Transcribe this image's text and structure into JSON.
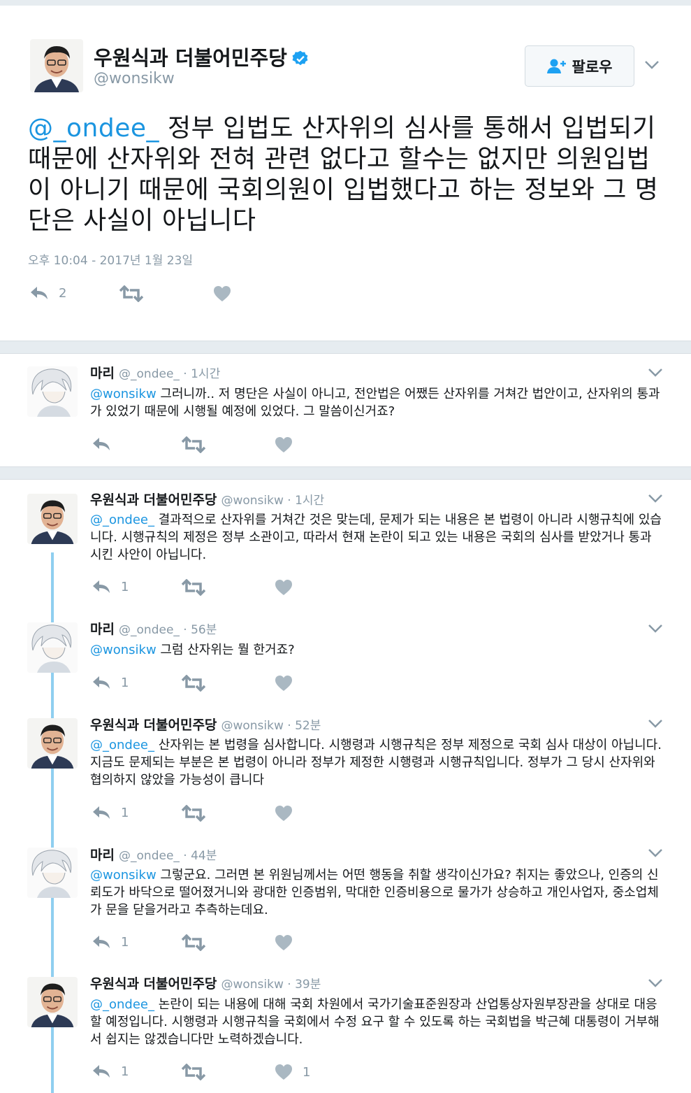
{
  "main_tweet": {
    "display_name": "우원식과 더불어민주당",
    "handle": "@wonsikw",
    "follow_label": "팔로우",
    "mention": "@_ondee_",
    "text": " 정부 입법도 산자위의 심사를 통해서 입법되기 때문에 산자위와 전혀 관련 없다고 할수는 없지만 의원입법이 아니기 때문에 국회의원이 입법했다고 하는 정보와 그 명단은 사실이 아닙니다",
    "timestamp": "오후 10:04 - 2017년 1월 23일",
    "reply_count": "2"
  },
  "replies": [
    {
      "name": "마리",
      "meta": "@_ondee_ · 1시간",
      "mention": "@wonsikw",
      "text": " 그러니까.. 저 명단은 사실이 아니고, 전안법은 어쨌든 산자위를 거쳐간 법안이고, 산자위의 통과가 있었기 때문에 시행될 예정에 있었다. 그 말씀이신거죠?",
      "reply_count": "",
      "like_count": ""
    },
    {
      "name": "우원식과 더불어민주당",
      "meta": "@wonsikw · 1시간",
      "mention": "@_ondee_",
      "text": " 결과적으로 산자위를 거쳐간 것은 맞는데, 문제가 되는 내용은 본 법령이 아니라 시행규칙에 있습니다. 시행규칙의 제정은 정부 소관이고, 따라서 현재 논란이 되고 있는 내용은 국회의 심사를 받았거나 통과시킨 사안이 아닙니다.",
      "reply_count": "1",
      "like_count": ""
    },
    {
      "name": "마리",
      "meta": "@_ondee_ · 56분",
      "mention": "@wonsikw",
      "text": " 그럼 산자위는 뭘 한거죠?",
      "reply_count": "1",
      "like_count": ""
    },
    {
      "name": "우원식과 더불어민주당",
      "meta": "@wonsikw · 52분",
      "mention": "@_ondee_",
      "text": " 산자위는 본 법령을 심사합니다. 시행령과 시행규칙은 정부 제정으로 국회 심사 대상이 아닙니다. 지금도 문제되는 부분은 본 법령이 아니라 정부가 제정한 시행령과 시행규칙입니다. 정부가 그 당시 산자위와 협의하지 않았을 가능성이 큽니다",
      "reply_count": "1",
      "like_count": ""
    },
    {
      "name": "마리",
      "meta": "@_ondee_ · 44분",
      "mention": "@wonsikw",
      "text": " 그렇군요. 그러면 본 위원님께서는 어떤 행동을 취할 생각이신가요? 취지는 좋았으나, 인증의 신뢰도가 바닥으로 떨어졌거니와 광대한 인증범위, 막대한 인증비용으로 물가가 상승하고 개인사업자, 중소업체가 문을 닫을거라고 추측하는데요.",
      "reply_count": "1",
      "like_count": ""
    },
    {
      "name": "우원식과 더불어민주당",
      "meta": "@wonsikw · 39분",
      "mention": "@_ondee_",
      "text": " 논란이 되는 내용에 대해 국회 차원에서 국가기술표준원장과 산업통상자원부장관을 상대로 대응할 예정입니다. 시행령과 시행규칙을 국회에서 수정 요구 할 수 있도록 하는 국회법을 박근혜 대통령이 거부해서 쉽지는 않겠습니다만 노력하겠습니다.",
      "reply_count": "1",
      "like_count": "1"
    }
  ],
  "colors": {
    "accent": "#1b95e0",
    "muted": "#8899a6",
    "thread": "#8fcff0",
    "separator": "#e6ecf0"
  }
}
